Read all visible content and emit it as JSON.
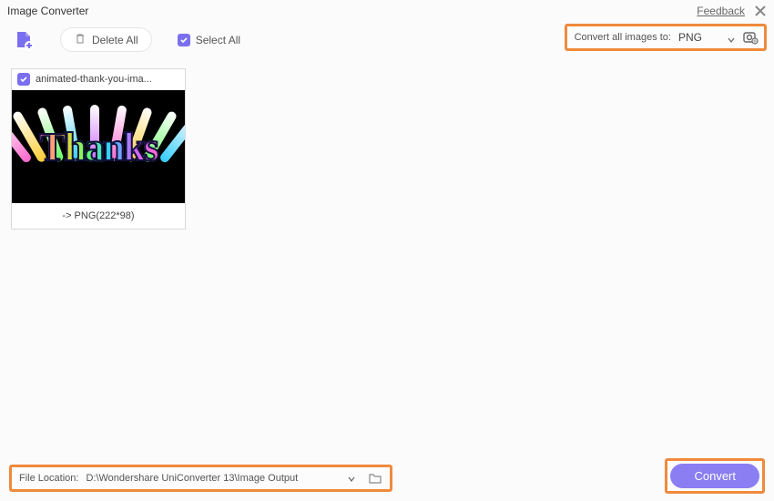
{
  "header": {
    "title": "Image Converter",
    "feedback": "Feedback"
  },
  "toolbar": {
    "delete_all": "Delete All",
    "select_all": "Select All",
    "convert_label": "Convert all images to:",
    "format": "PNG"
  },
  "card": {
    "filename": "animated-thank-you-ima...",
    "thumb_text": "Thanks",
    "output_info": "-> PNG(222*98)"
  },
  "footer": {
    "location_label": "File Location:",
    "path": "D:\\Wondershare UniConverter 13\\Image Output",
    "convert": "Convert"
  },
  "colors": {
    "highlight": "#f08a3c",
    "accent": "#8b7df2"
  }
}
